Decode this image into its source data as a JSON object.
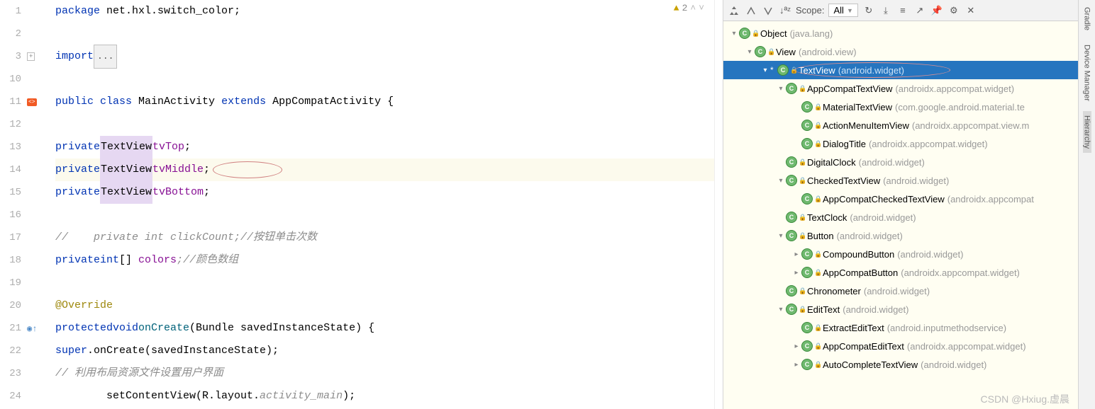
{
  "editor": {
    "lines": [
      {
        "n": "1",
        "t": "package",
        "rest": " net.hxl.switch_color;"
      },
      {
        "n": "2",
        "t": ""
      },
      {
        "n": "3",
        "t": "import",
        "fold": "..."
      },
      {
        "n": "10",
        "t": ""
      },
      {
        "n": "11",
        "t": "class",
        "pre": "public ",
        "cls": "MainActivity",
        "ext": " extends ",
        "sup": "AppCompatActivity",
        "end": " {"
      },
      {
        "n": "12",
        "t": ""
      },
      {
        "n": "13",
        "t": "field",
        "kw": "private",
        "ty": "TextView",
        "nm": "tvTop",
        "end": ";"
      },
      {
        "n": "14",
        "t": "field",
        "kw": "private",
        "ty": "TextView",
        "nm": "tvMiddle",
        "end": ";",
        "hl": true,
        "circle": true
      },
      {
        "n": "15",
        "t": "field",
        "kw": "private",
        "ty": "TextView",
        "nm": "tvBottom",
        "end": ";"
      },
      {
        "n": "16",
        "t": ""
      },
      {
        "n": "17",
        "t": "com",
        "txt": "//    private int clickCount;//按钮单击次数"
      },
      {
        "n": "18",
        "t": "arr",
        "kw": "private",
        "ty": "int",
        "nm": "colors",
        "com": ";//颜色数组"
      },
      {
        "n": "19",
        "t": ""
      },
      {
        "n": "20",
        "t": "ann",
        "txt": "@Override"
      },
      {
        "n": "21",
        "t": "method",
        "kw": "protected",
        "ret": "void",
        "nm": "onCreate",
        "params": "(Bundle savedInstanceState) {"
      },
      {
        "n": "22",
        "t": "call",
        "obj": "super",
        "m": ".onCreate",
        "args": "(savedInstanceState);"
      },
      {
        "n": "23",
        "t": "com2",
        "txt": "// 利用布局资源文件设置用户界面"
      },
      {
        "n": "24",
        "t": "call2",
        "m": "setContentView",
        "args": "(R.layout.",
        "it": "activity_main",
        "end": ");"
      }
    ],
    "inspect_count": "2"
  },
  "hierarchy": {
    "scope_label": "Scope:",
    "scope_value": "All",
    "tree": [
      {
        "d": 0,
        "arr": "v",
        "name": "Object",
        "pkg": "(java.lang)"
      },
      {
        "d": 1,
        "arr": "v",
        "name": "View",
        "pkg": "(android.view)"
      },
      {
        "d": 2,
        "arr": "v",
        "star": true,
        "name": "TextView",
        "pkg": "(android.widget)",
        "sel": true,
        "circle": true
      },
      {
        "d": 3,
        "arr": "v",
        "name": "AppCompatTextView",
        "pkg": "(androidx.appcompat.widget)"
      },
      {
        "d": 4,
        "arr": "",
        "name": "MaterialTextView",
        "pkg": "(com.google.android.material.te"
      },
      {
        "d": 4,
        "arr": "",
        "name": "ActionMenuItemView",
        "pkg": "(androidx.appcompat.view.m"
      },
      {
        "d": 4,
        "arr": "",
        "name": "DialogTitle",
        "pkg": "(androidx.appcompat.widget)"
      },
      {
        "d": 3,
        "arr": "",
        "name": "DigitalClock",
        "pkg": "(android.widget)"
      },
      {
        "d": 3,
        "arr": "v",
        "name": "CheckedTextView",
        "pkg": "(android.widget)"
      },
      {
        "d": 4,
        "arr": "",
        "name": "AppCompatCheckedTextView",
        "pkg": "(androidx.appcompat"
      },
      {
        "d": 3,
        "arr": "",
        "name": "TextClock",
        "pkg": "(android.widget)"
      },
      {
        "d": 3,
        "arr": "v",
        "name": "Button",
        "pkg": "(android.widget)"
      },
      {
        "d": 4,
        "arr": ">",
        "name": "CompoundButton",
        "pkg": "(android.widget)"
      },
      {
        "d": 4,
        "arr": ">",
        "name": "AppCompatButton",
        "pkg": "(androidx.appcompat.widget)"
      },
      {
        "d": 3,
        "arr": "",
        "name": "Chronometer",
        "pkg": "(android.widget)"
      },
      {
        "d": 3,
        "arr": "v",
        "name": "EditText",
        "pkg": "(android.widget)"
      },
      {
        "d": 4,
        "arr": "",
        "name": "ExtractEditText",
        "pkg": "(android.inputmethodservice)"
      },
      {
        "d": 4,
        "arr": ">",
        "name": "AppCompatEditText",
        "pkg": "(androidx.appcompat.widget)"
      },
      {
        "d": 4,
        "arr": ">",
        "name": "AutoCompleteTextView",
        "pkg": "(android.widget)"
      }
    ]
  },
  "right_tabs": [
    "Gradle",
    "Device Manager",
    "Hierarchy"
  ],
  "watermark": "CSDN @Hxiug.虚晨"
}
